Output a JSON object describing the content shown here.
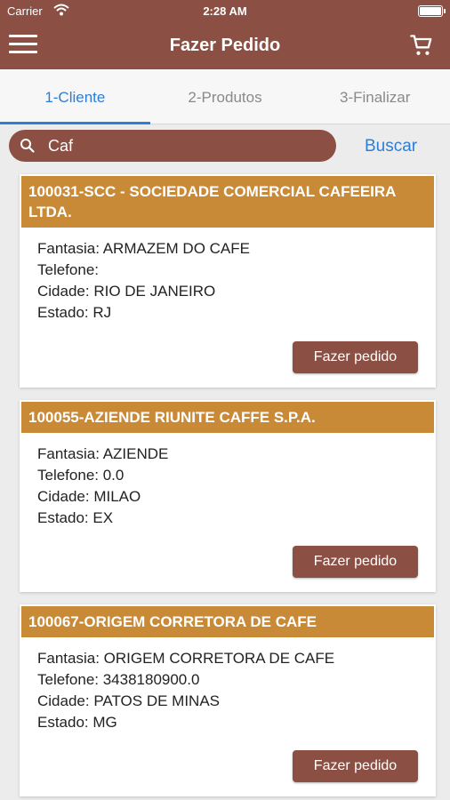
{
  "status_bar": {
    "carrier": "Carrier",
    "time": "2:28 AM"
  },
  "header": {
    "title": "Fazer Pedido"
  },
  "tabs": [
    {
      "label": "1-Cliente",
      "active": true
    },
    {
      "label": "2-Produtos",
      "active": false
    },
    {
      "label": "3-Finalizar",
      "active": false
    }
  ],
  "search": {
    "value": "Caf",
    "button_label": "Buscar"
  },
  "clients": [
    {
      "header": "100031-SCC - SOCIEDADE COMERCIAL CAFEEIRA LTDA.",
      "fantasia": "Fantasia: ARMAZEM DO CAFE",
      "telefone": "Telefone:",
      "cidade": "Cidade: RIO DE JANEIRO",
      "estado": "Estado: RJ",
      "button": "Fazer pedido"
    },
    {
      "header": "100055-AZIENDE RIUNITE CAFFE S.P.A.",
      "fantasia": "Fantasia: AZIENDE",
      "telefone": "Telefone: 0.0",
      "cidade": "Cidade: MILAO",
      "estado": "Estado: EX",
      "button": "Fazer pedido"
    },
    {
      "header": "100067-ORIGEM CORRETORA DE CAFE",
      "fantasia": "Fantasia: ORIGEM CORRETORA DE CAFE",
      "telefone": "Telefone: 3438180900.0",
      "cidade": "Cidade: PATOS DE MINAS",
      "estado": "Estado: MG",
      "button": "Fazer pedido"
    }
  ],
  "colors": {
    "primary": "#8b5043",
    "card_header": "#c98a37",
    "accent": "#2e7dd6"
  },
  "icons": [
    "wifi-icon",
    "battery-icon",
    "menu-icon",
    "cart-icon",
    "search-icon"
  ]
}
